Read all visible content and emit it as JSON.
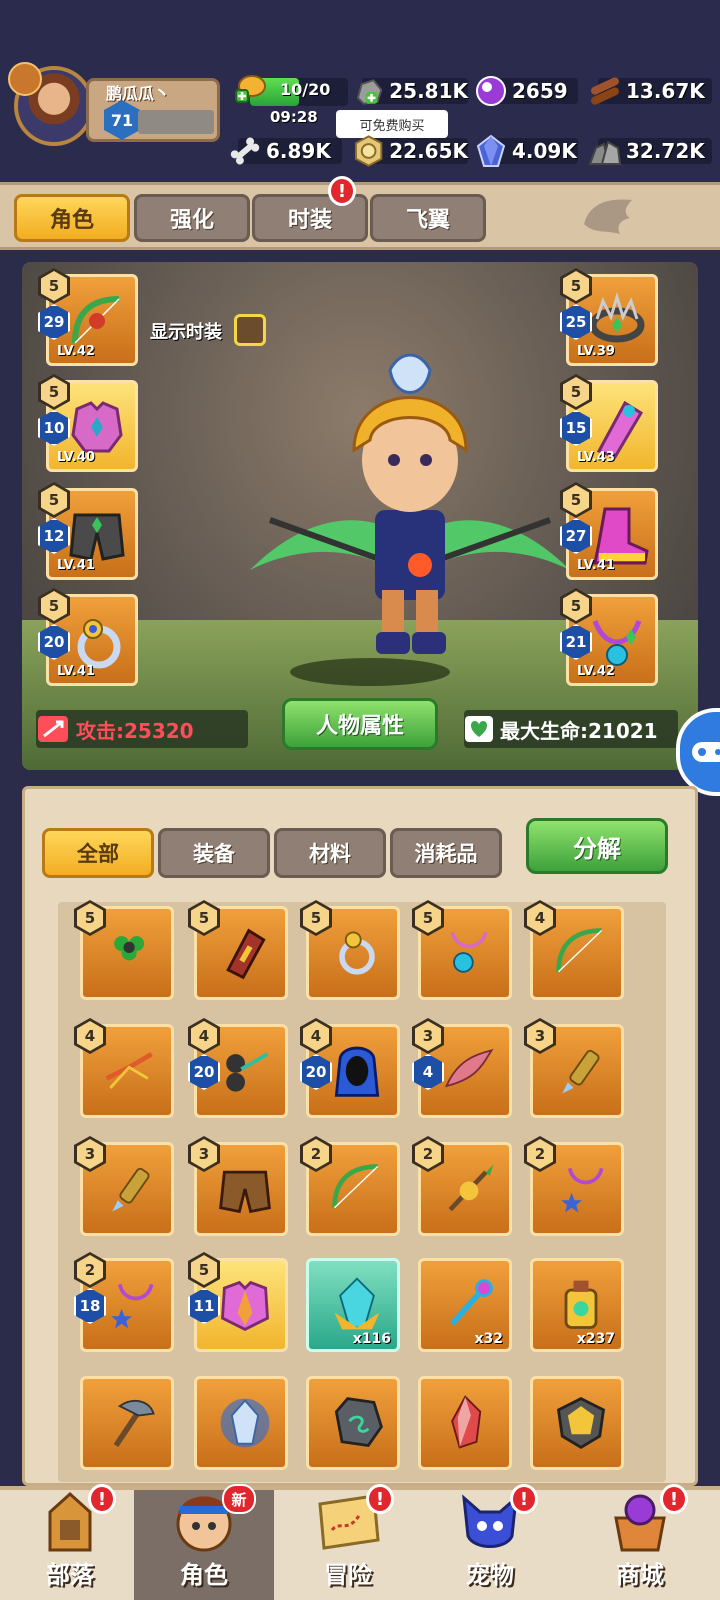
{
  "player": {
    "name": "鹏瓜瓜丶",
    "level": "71"
  },
  "stamina": {
    "text": "10/20",
    "timer": "09:28",
    "fill_fraction": 0.5
  },
  "resources": {
    "stone": "25.81K",
    "gem": "2659",
    "wood": "13.67K",
    "bone": "6.89K",
    "coin": "22.65K",
    "crystal": "4.09K",
    "ore": "32.72K"
  },
  "tooltip": "可免费购买",
  "tabs": [
    {
      "label": "角色",
      "active": true
    },
    {
      "label": "强化",
      "active": false
    },
    {
      "label": "时装",
      "active": false,
      "badge": "!"
    },
    {
      "label": "飞翼",
      "active": false
    }
  ],
  "character": {
    "show_fashion_label": "显示时装",
    "attr_button": "人物属性",
    "attack_label": "攻击:25320",
    "hp_label": "最大生命:21021"
  },
  "equip_left": [
    {
      "stars": "5",
      "enh": "29",
      "lv": "LV.42",
      "icon": "bow-icon"
    },
    {
      "stars": "5",
      "enh": "10",
      "lv": "LV.40",
      "icon": "armor-icon"
    },
    {
      "stars": "5",
      "enh": "12",
      "lv": "LV.41",
      "icon": "pants-icon"
    },
    {
      "stars": "5",
      "enh": "20",
      "lv": "LV.41",
      "icon": "ring-icon"
    }
  ],
  "equip_right": [
    {
      "stars": "5",
      "enh": "25",
      "lv": "LV.39",
      "icon": "crown-icon"
    },
    {
      "stars": "5",
      "enh": "15",
      "lv": "LV.43",
      "icon": "bracer-icon"
    },
    {
      "stars": "5",
      "enh": "27",
      "lv": "LV.41",
      "icon": "boots-icon"
    },
    {
      "stars": "5",
      "enh": "21",
      "lv": "LV.42",
      "icon": "necklace-icon"
    }
  ],
  "inventory_tabs": [
    {
      "label": "全部",
      "active": true
    },
    {
      "label": "装备",
      "active": false
    },
    {
      "label": "材料",
      "active": false
    },
    {
      "label": "消耗品",
      "active": false
    }
  ],
  "decompose_label": "分解",
  "inventory": [
    {
      "stars": "5",
      "icon": "clover-necklace-icon"
    },
    {
      "stars": "5",
      "icon": "bracer-icon"
    },
    {
      "stars": "5",
      "icon": "ring-icon"
    },
    {
      "stars": "5",
      "icon": "pendant-icon"
    },
    {
      "stars": "4",
      "icon": "bow-icon"
    },
    {
      "stars": "4",
      "icon": "crossbow-icon"
    },
    {
      "stars": "4",
      "enh": "20",
      "icon": "dual-bow-icon"
    },
    {
      "stars": "4",
      "enh": "20",
      "icon": "hood-icon"
    },
    {
      "stars": "3",
      "enh": "4",
      "icon": "wing-bow-icon"
    },
    {
      "stars": "3",
      "icon": "dagger-icon"
    },
    {
      "stars": "3",
      "icon": "dagger-icon"
    },
    {
      "stars": "3",
      "icon": "pants-icon"
    },
    {
      "stars": "2",
      "icon": "bow-icon"
    },
    {
      "stars": "2",
      "icon": "spear-icon"
    },
    {
      "stars": "2",
      "icon": "star-necklace-icon"
    },
    {
      "stars": "2",
      "enh": "18",
      "icon": "star-necklace-icon"
    },
    {
      "stars": "5",
      "enh": "11",
      "icon": "chest-armor-icon"
    },
    {
      "qty": "x116",
      "icon": "crystal-shard-icon"
    },
    {
      "qty": "x32",
      "icon": "key-icon"
    },
    {
      "qty": "x237",
      "icon": "potion-icon"
    },
    {
      "icon": "hammer-icon"
    },
    {
      "icon": "glowing-gem-icon"
    },
    {
      "icon": "rune-stone-icon"
    },
    {
      "icon": "red-crystal-icon"
    },
    {
      "icon": "gold-emblem-icon"
    }
  ],
  "bottom_nav": [
    {
      "label": "部落",
      "badge": "!"
    },
    {
      "label": "角色",
      "badge_new": "新",
      "active": true
    },
    {
      "label": "冒险",
      "badge": "!"
    },
    {
      "label": "宠物",
      "badge": "!"
    },
    {
      "label": "商城",
      "badge": "!"
    }
  ],
  "colors": {
    "bg": "#2b2b4a",
    "tab_active": "#f2ad22",
    "green_button": "#3da13a",
    "slot_orange": "#e08a2a",
    "red_badge": "#e1262d",
    "attack_red": "#ff4d5a",
    "hp_white": "#ffffff"
  }
}
